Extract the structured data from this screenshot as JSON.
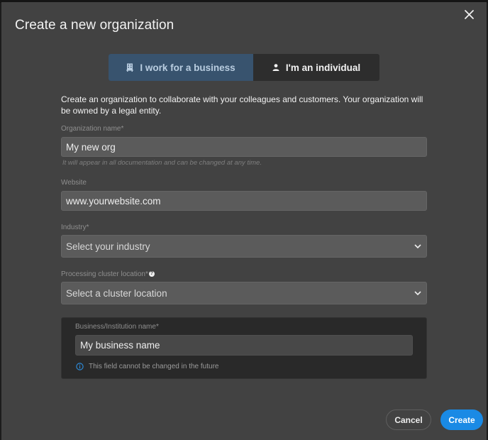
{
  "dialog": {
    "title": "Create a new organization",
    "close_icon": "close-icon"
  },
  "account_type_toggle": {
    "options": [
      {
        "label": "I work for a business",
        "icon": "building-icon",
        "selected": true
      },
      {
        "label": "I'm an individual",
        "icon": "person-icon",
        "selected": false
      }
    ]
  },
  "description": "Create an organization to collaborate with your colleagues and customers. Your organization will be owned by a legal entity.",
  "form": {
    "organization_name": {
      "label": "Organization name*",
      "value": "My new org",
      "hint": "It will appear in all documentation and can be changed at any time."
    },
    "website": {
      "label": "Website",
      "value": "www.yourwebsite.com"
    },
    "industry": {
      "label": "Industry*",
      "placeholder": "Select your industry"
    },
    "cluster_location": {
      "label": "Processing cluster location*",
      "help_icon": "question-icon",
      "placeholder": "Select a cluster location"
    },
    "business_name": {
      "label": "Business/Institution name*",
      "value": "My business name",
      "info": "This field cannot be changed in the future",
      "info_icon": "info-icon"
    }
  },
  "actions": {
    "cancel_label": "Cancel",
    "create_label": "Create"
  },
  "colors": {
    "accent": "#1a8ae5",
    "toggle_active": "#38536e",
    "modal_bg": "#424242"
  }
}
